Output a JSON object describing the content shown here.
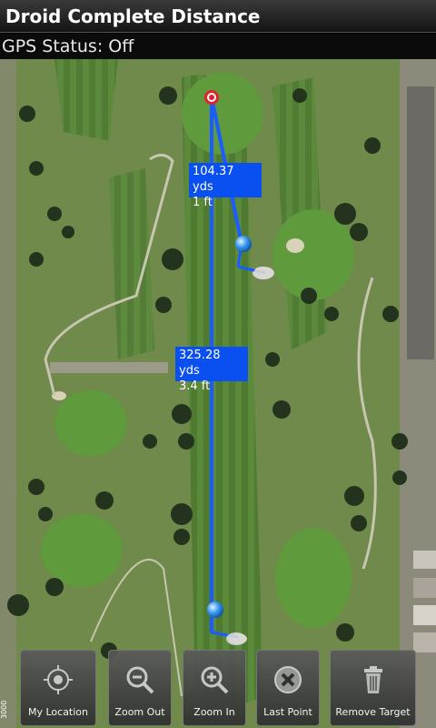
{
  "app": {
    "title": "Droid Complete Distance",
    "gps_status": "GPS Status: Off"
  },
  "measurements": [
    {
      "distance": "104.37 yds",
      "elevation": "1 ft"
    },
    {
      "distance": "325.28 yds",
      "elevation": "3.4 ft"
    }
  ],
  "toolbar": {
    "buttons": [
      {
        "label": "My Location",
        "icon": "crosshair-icon"
      },
      {
        "label": "Zoom Out",
        "icon": "zoom-out-icon"
      },
      {
        "label": "Zoom In",
        "icon": "zoom-in-icon"
      },
      {
        "label": "Last Point",
        "icon": "close-circle-icon"
      },
      {
        "label": "Remove Target",
        "icon": "trash-icon"
      }
    ]
  },
  "map": {
    "scale_text": "3000",
    "colors": {
      "line": "#1a5cff",
      "label_bg": "#0a4ff0",
      "target": "#e0202a",
      "marker": "#2f8fe8"
    }
  }
}
